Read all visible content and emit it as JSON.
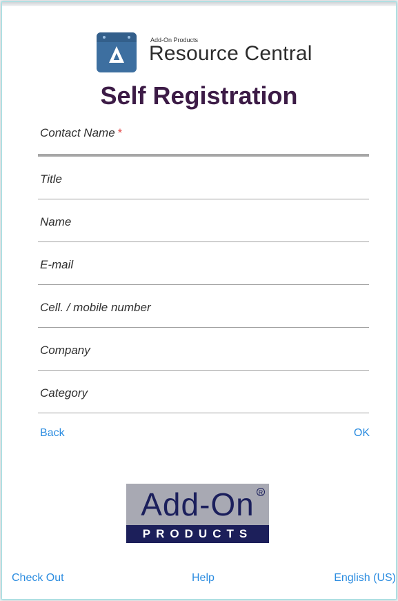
{
  "brand": {
    "vendor": "Add-On Products",
    "product": "Resource Central",
    "logo_icon": "calendar-a-icon",
    "logo_color": "#3d6fa0"
  },
  "page": {
    "title": "Self Registration"
  },
  "form": {
    "section_label": "Contact Name",
    "required_marker": "*",
    "fields": [
      {
        "label": "Title"
      },
      {
        "label": "Name"
      },
      {
        "label": "E-mail"
      },
      {
        "label": "Cell. / mobile number"
      },
      {
        "label": "Company"
      },
      {
        "label": "Category"
      }
    ]
  },
  "actions": {
    "back": "Back",
    "ok": "OK"
  },
  "footer_logo": {
    "word": "Add-On",
    "sub": "PRODUCTS",
    "registered": "R"
  },
  "footer": {
    "checkout": "Check Out",
    "help": "Help",
    "language": "English (US)"
  },
  "colors": {
    "title": "#3c1b46",
    "link": "#2b8ce0",
    "required": "#e24545"
  }
}
